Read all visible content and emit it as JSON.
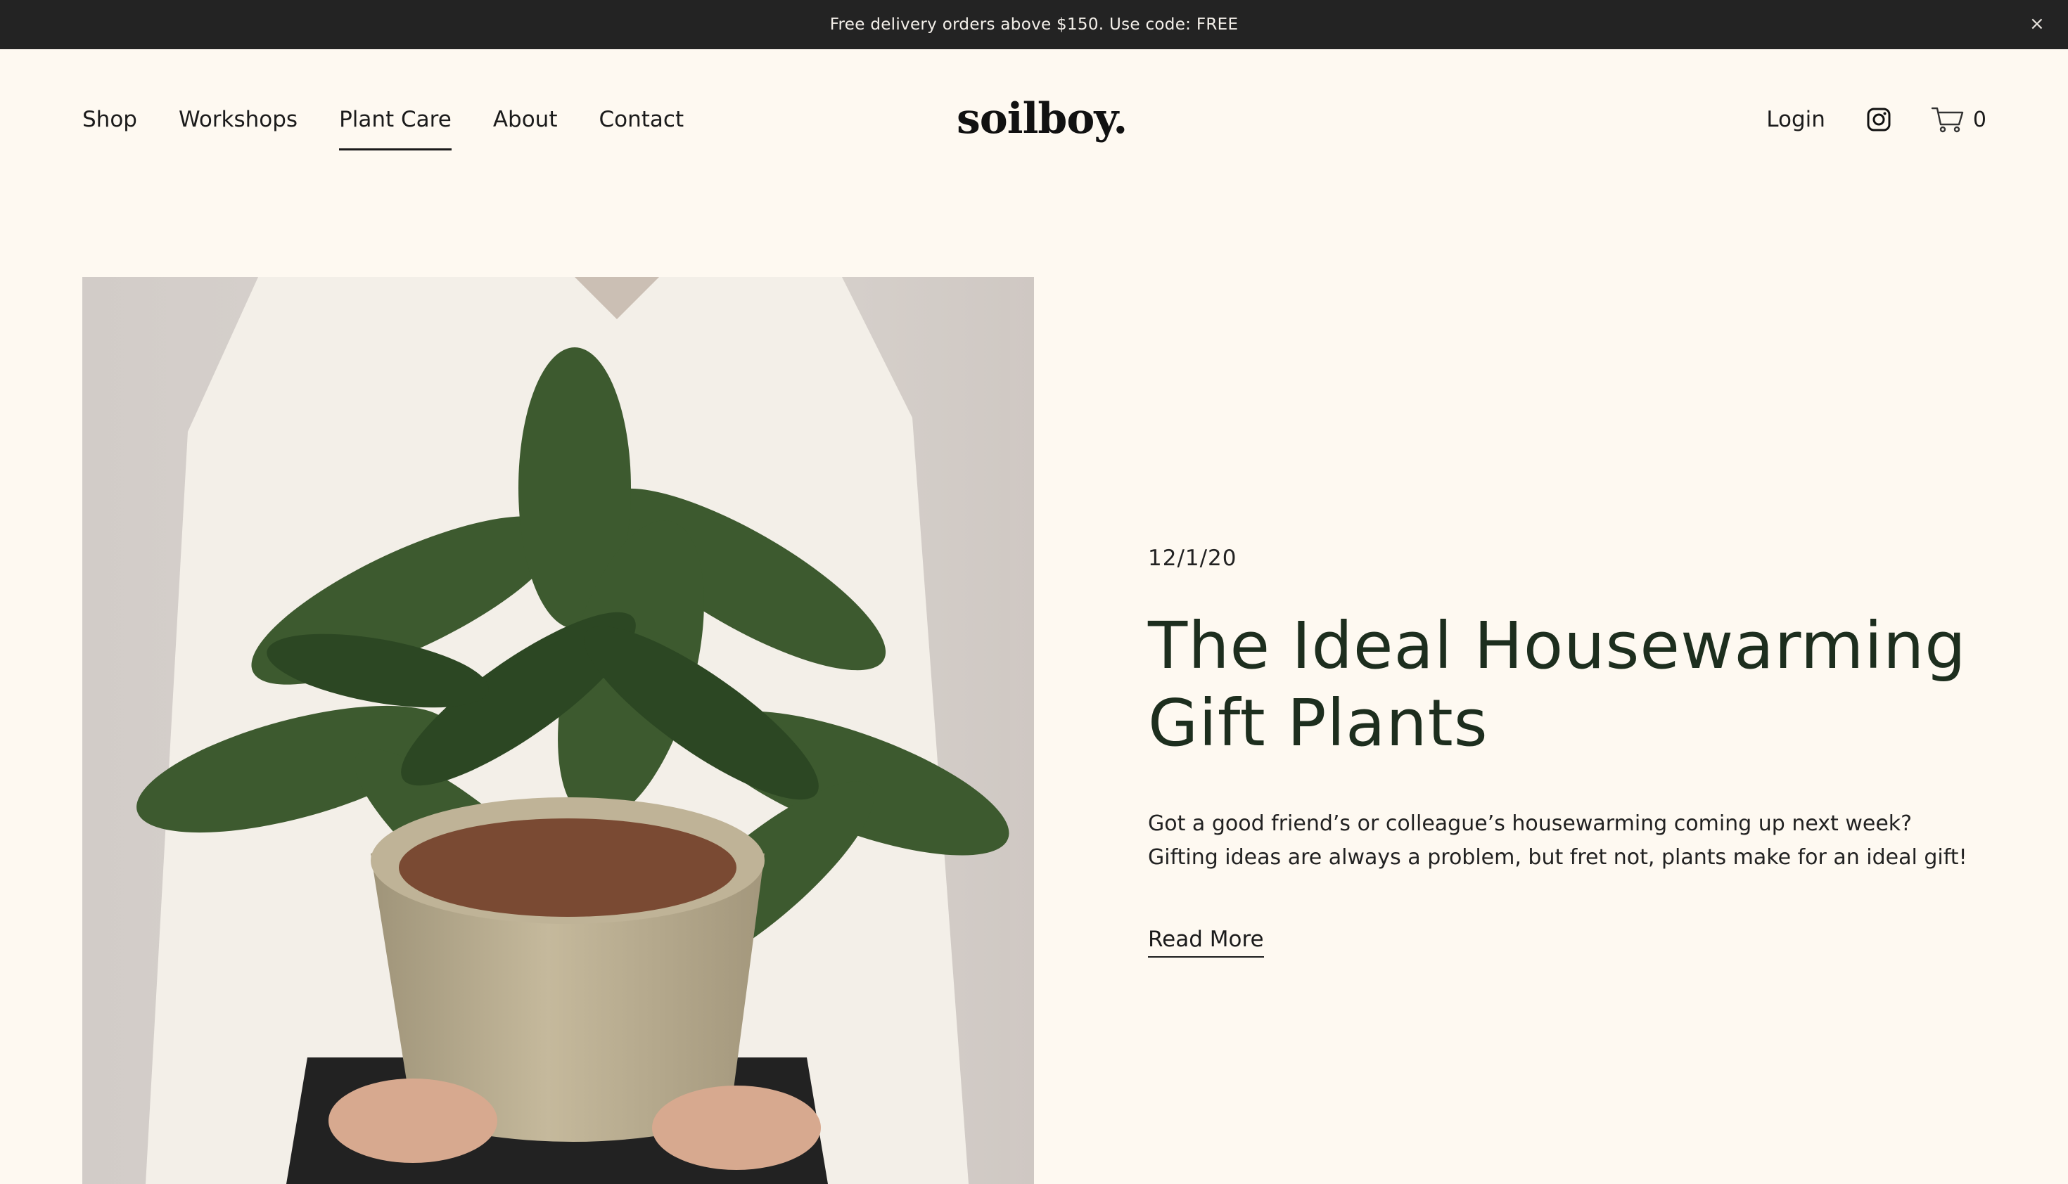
{
  "announcement": {
    "text": "Free delivery orders above $150. Use code: FREE",
    "close_glyph": "×"
  },
  "nav": {
    "items": [
      {
        "label": "Shop",
        "active": false
      },
      {
        "label": "Workshops",
        "active": false
      },
      {
        "label": "Plant Care",
        "active": true
      },
      {
        "label": "About",
        "active": false
      },
      {
        "label": "Contact",
        "active": false
      }
    ]
  },
  "brand": {
    "logo_text": "soilboy."
  },
  "header_right": {
    "login_label": "Login",
    "instagram_icon": "instagram-icon",
    "cart_icon": "cart-icon",
    "cart_count": "0"
  },
  "article": {
    "date": "12/1/20",
    "title": "The Ideal Housewarming Gift Plants",
    "excerpt": "Got a good friend’s or colleague’s housewarming coming up next week? Gifting ideas are always a problem, but fret not, plants make for an ideal gift!",
    "read_more_label": "Read More"
  },
  "colors": {
    "page_background": "#fef9f1",
    "announcement_background": "#232323",
    "title_color": "#1d2e1e"
  }
}
